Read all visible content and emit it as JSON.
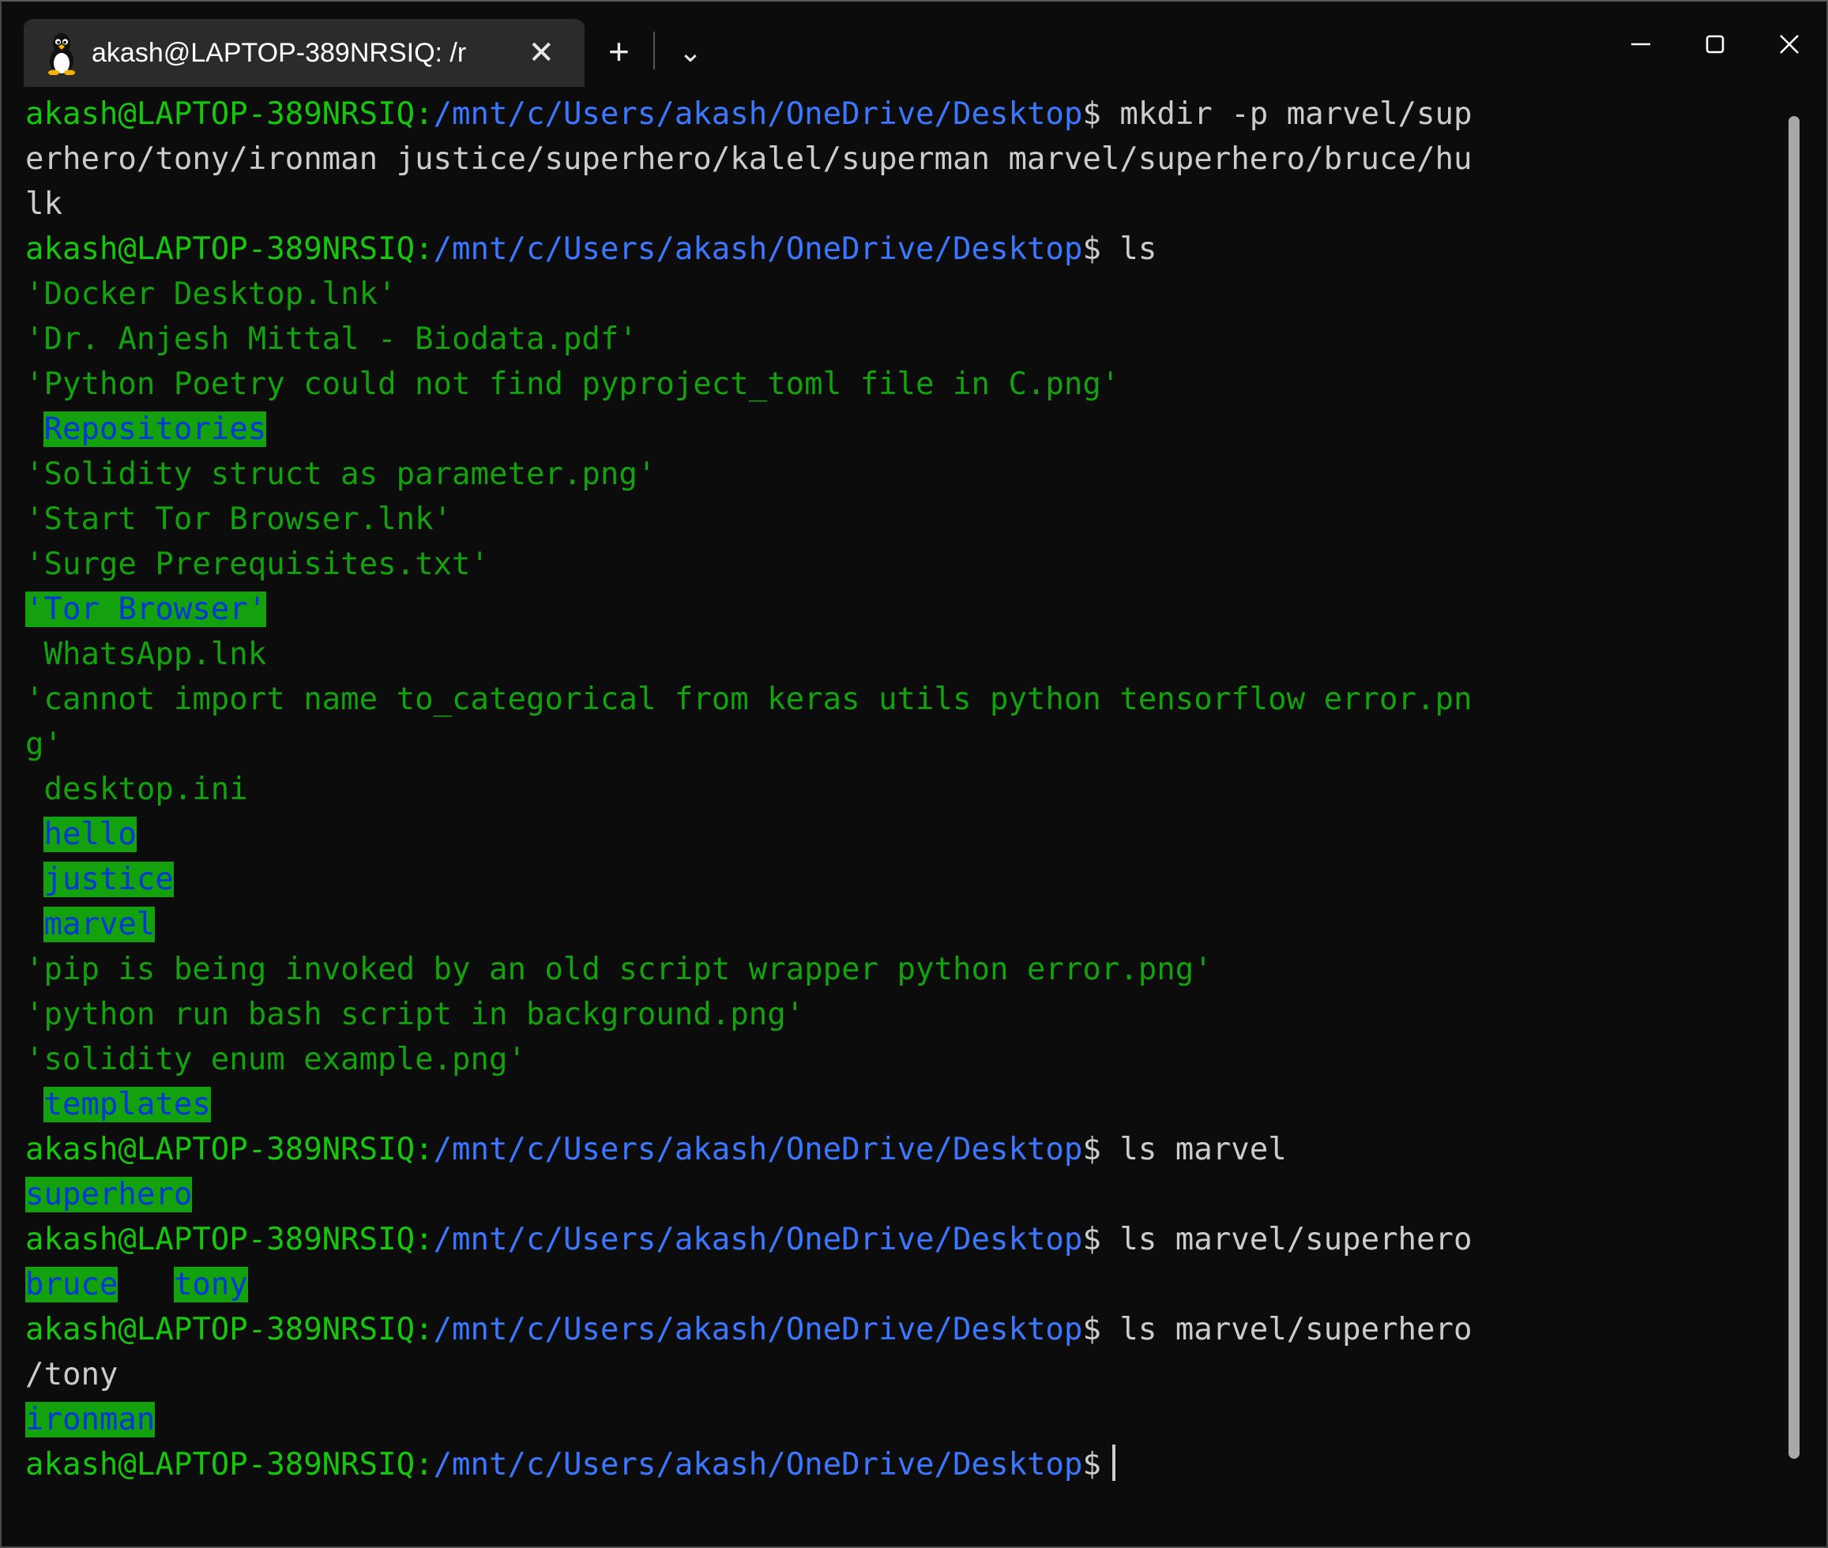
{
  "window": {
    "app": "Windows Terminal",
    "background": "#0c0c0c",
    "controls": {
      "minimize": "minimize-icon",
      "maximize": "maximize-icon",
      "close": "close-icon"
    }
  },
  "tabbar": {
    "tab_title": "akash@LAPTOP-389NRSIQ: /r",
    "tab_icon": "tux-linux-icon",
    "close_label": "✕",
    "new_tab_label": "+",
    "dropdown_label": "⌄"
  },
  "colors": {
    "prompt_user": "#16c60c",
    "prompt_path": "#3b78ff",
    "command_text": "#cccccc",
    "file_green": "#13a10e",
    "dir_bg": "#13a10e",
    "dir_fg": "#0037da",
    "terminal_bg": "#0c0c0c",
    "tab_bg": "#2b2b2b",
    "scrollbar": "#a8a8a8"
  },
  "prompt": {
    "user_host": "akash@LAPTOP-389NRSIQ",
    "colon": ":",
    "path": "/mnt/c/Users/akash/OneDrive/Desktop",
    "sigil": "$"
  },
  "terminal": {
    "lines": [
      {
        "type": "prompt",
        "command": " mkdir -p marvel/sup"
      },
      {
        "type": "cont",
        "text": "erhero/tony/ironman justice/superhero/kalel/superman marvel/superhero/bruce/hu",
        "color": "w"
      },
      {
        "type": "cont",
        "text": "lk",
        "color": "w"
      },
      {
        "type": "prompt",
        "command": " ls"
      },
      {
        "type": "file",
        "text": "'Docker Desktop.lnk'"
      },
      {
        "type": "file",
        "text": "'Dr. Anjesh Mittal - Biodata.pdf'"
      },
      {
        "type": "file",
        "text": "'Python Poetry could not find pyproject_toml file in C.png'"
      },
      {
        "type": "dir",
        "indent": 1,
        "text": "Repositories"
      },
      {
        "type": "file",
        "text": "'Solidity struct as parameter.png'"
      },
      {
        "type": "file",
        "text": "'Start Tor Browser.lnk'"
      },
      {
        "type": "file",
        "text": "'Surge Prerequisites.txt'"
      },
      {
        "type": "dir",
        "indent": 0,
        "text": "'Tor Browser'"
      },
      {
        "type": "file",
        "indent": 1,
        "text": "WhatsApp.lnk"
      },
      {
        "type": "file",
        "text": "'cannot import name to_categorical from keras utils python tensorflow error.pn"
      },
      {
        "type": "file",
        "text": "g'"
      },
      {
        "type": "file",
        "indent": 1,
        "text": "desktop.ini"
      },
      {
        "type": "dir",
        "indent": 1,
        "text": "hello"
      },
      {
        "type": "dir",
        "indent": 1,
        "text": "justice"
      },
      {
        "type": "dir",
        "indent": 1,
        "text": "marvel"
      },
      {
        "type": "file",
        "text": "'pip is being invoked by an old script wrapper python error.png'"
      },
      {
        "type": "file",
        "text": "'python run bash script in background.png'"
      },
      {
        "type": "file",
        "text": "'solidity enum example.png'"
      },
      {
        "type": "dir",
        "indent": 1,
        "text": "templates"
      },
      {
        "type": "prompt",
        "command": " ls marvel"
      },
      {
        "type": "dir",
        "indent": 0,
        "text": "superhero"
      },
      {
        "type": "prompt",
        "command": " ls marvel/superhero"
      },
      {
        "type": "dirrow",
        "indent": 0,
        "items": [
          "bruce",
          "tony"
        ],
        "gap": 3
      },
      {
        "type": "prompt",
        "command": " ls marvel/superhero"
      },
      {
        "type": "cont",
        "text": "/tony",
        "color": "w"
      },
      {
        "type": "dir",
        "indent": 0,
        "text": "ironman"
      },
      {
        "type": "prompt",
        "command": "",
        "cursor": true
      }
    ]
  },
  "scrollbar": {
    "name": "vertical-scrollbar",
    "thumb_position_pct": 2,
    "thumb_size_pct": 92
  }
}
